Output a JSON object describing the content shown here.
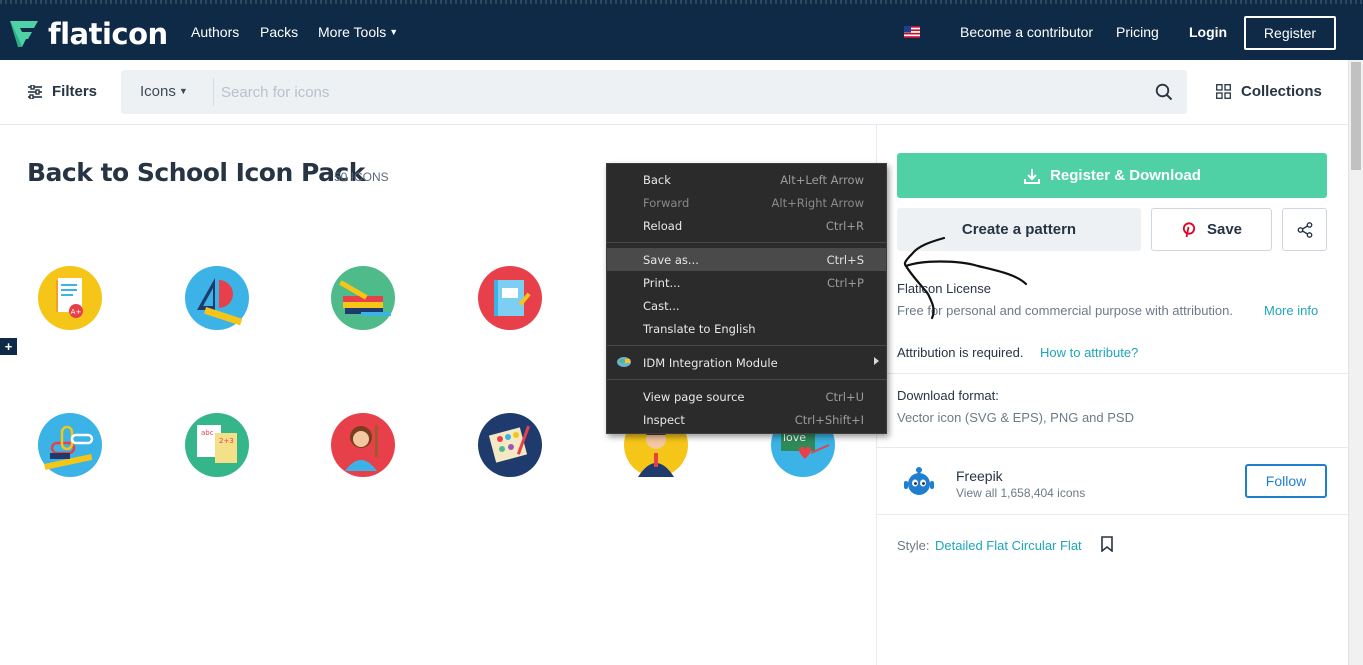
{
  "header": {
    "logo_text": "flaticon",
    "nav": [
      {
        "label": "Authors"
      },
      {
        "label": "Packs"
      },
      {
        "label": "More Tools"
      }
    ],
    "contributor_label": "Become a contributor",
    "pricing_label": "Pricing",
    "login_label": "Login",
    "register_label": "Register"
  },
  "search": {
    "filters_label": "Filters",
    "type_label": "Icons",
    "placeholder": "Search for icons",
    "collections_label": "Collections"
  },
  "pack": {
    "title": "Back to School Icon Pack",
    "count": "50 ICONS",
    "icons": [
      {
        "name": "report-card-icon",
        "bg": "#f5c518"
      },
      {
        "name": "geometry-tools-icon",
        "bg": "#3bb3e6"
      },
      {
        "name": "pencils-books-icon",
        "bg": "#4fba8a"
      },
      {
        "name": "notebook-icon",
        "bg": "#e8404a"
      },
      {
        "name": "paperclips-icon",
        "bg": "#3bb3e6"
      },
      {
        "name": "worksheet-icon",
        "bg": "#35b58a"
      },
      {
        "name": "teacher-icon",
        "bg": "#e8404a"
      },
      {
        "name": "paint-palette-icon",
        "bg": "#1f3b6e"
      },
      {
        "name": "student-icon",
        "bg": "#f5c518"
      },
      {
        "name": "love-board-icon",
        "bg": "#3bb3e6"
      }
    ]
  },
  "sidebar": {
    "download_label": "Register & Download",
    "pattern_label": "Create a pattern",
    "save_label": "Save",
    "license_title": "Flaticon License",
    "license_text": "Free for personal and commercial purpose with attribution.",
    "license_link": "More info",
    "attribution_text": "Attribution is required.",
    "attribution_link": "How to attribute?",
    "format_title": "Download format:",
    "format_text": "Vector icon (SVG & EPS), PNG and PSD",
    "author_name": "Freepik",
    "author_sub": "View all 1,658,404 icons",
    "follow_label": "Follow",
    "style_label": "Style:",
    "style_link": "Detailed Flat Circular Flat"
  },
  "context_menu": {
    "items": [
      {
        "label": "Back",
        "shortcut": "Alt+Left Arrow"
      },
      {
        "label": "Forward",
        "shortcut": "Alt+Right Arrow"
      },
      {
        "label": "Reload",
        "shortcut": "Ctrl+R"
      },
      {
        "label": "Save as...",
        "shortcut": "Ctrl+S"
      },
      {
        "label": "Print...",
        "shortcut": "Ctrl+P"
      },
      {
        "label": "Cast...",
        "shortcut": ""
      },
      {
        "label": "Translate to English",
        "shortcut": ""
      },
      {
        "label": "IDM Integration Module",
        "shortcut": ""
      },
      {
        "label": "View page source",
        "shortcut": "Ctrl+U"
      },
      {
        "label": "Inspect",
        "shortcut": "Ctrl+Shift+I"
      }
    ]
  },
  "colors": {
    "header_bg": "#0e2a47",
    "accent_green": "#4fd1a5",
    "link_teal": "#1fa5b9",
    "follow_blue": "#1f7ecf"
  }
}
